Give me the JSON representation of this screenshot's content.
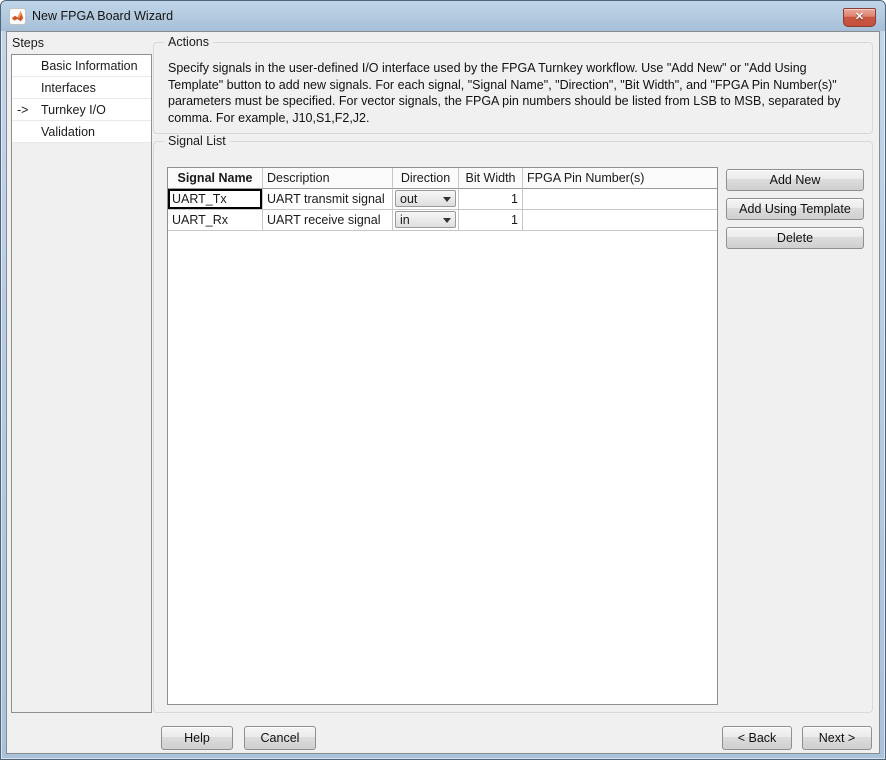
{
  "window": {
    "title": "New FPGA Board Wizard",
    "close_glyph": "✕"
  },
  "colors": {
    "titlebar_blue": "#b3cadf",
    "dialog_bg": "#f0f0f0",
    "close_button_red": "#c4503c",
    "matlab_orange": "#e8703a"
  },
  "steps": {
    "label": "Steps",
    "active_marker": "->",
    "items": [
      {
        "label": "Basic Information",
        "active": false
      },
      {
        "label": "Interfaces",
        "active": false
      },
      {
        "label": "Turnkey I/O",
        "active": true
      },
      {
        "label": "Validation",
        "active": false
      }
    ]
  },
  "actions": {
    "label": "Actions",
    "text": "Specify signals in the user-defined I/O interface used by the FPGA Turnkey workflow. Use \"Add New\" or \"Add Using Template\" button to add new signals. For each signal, \"Signal Name\", \"Direction\", \"Bit Width\", and \"FPGA Pin Number(s)\" parameters must be specified. For vector signals, the FPGA pin numbers should be listed from LSB to MSB, separated by comma. For example, J10,S1,F2,J2."
  },
  "signal_list": {
    "label": "Signal List",
    "columns": [
      "Signal Name",
      "Description",
      "Direction",
      "Bit Width",
      "FPGA Pin Number(s)"
    ],
    "rows": [
      {
        "signal_name": "UART_Tx",
        "description": "UART transmit signal",
        "direction": "out",
        "bit_width": "1",
        "fpga_pins": "",
        "focused": true
      },
      {
        "signal_name": "UART_Rx",
        "description": "UART receive signal",
        "direction": "in",
        "bit_width": "1",
        "fpga_pins": "",
        "focused": false
      }
    ],
    "buttons": {
      "add_new": "Add New",
      "add_template": "Add Using Template",
      "delete": "Delete"
    }
  },
  "footer": {
    "help": "Help",
    "cancel": "Cancel",
    "back": "< Back",
    "next": "Next >"
  }
}
